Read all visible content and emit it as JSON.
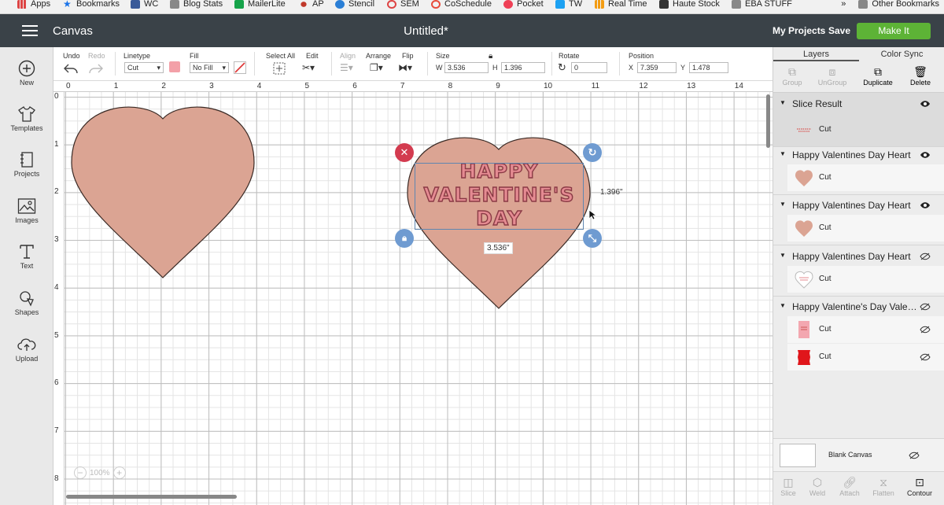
{
  "bookmarks": {
    "items": [
      {
        "label": "Apps",
        "color": "#d44"
      },
      {
        "label": "Bookmarks",
        "color": "#1a73e8"
      },
      {
        "label": "WC",
        "color": "#3a5a99"
      },
      {
        "label": "Blog Stats",
        "color": "#888"
      },
      {
        "label": "MailerLite",
        "color": "#16a34a"
      },
      {
        "label": "AP",
        "color": "#c0392b"
      },
      {
        "label": "Stencil",
        "color": "#2b7fd6"
      },
      {
        "label": "SEM",
        "color": "#d44"
      },
      {
        "label": "CoSchedule",
        "color": "#e74c3c"
      },
      {
        "label": "Pocket",
        "color": "#ef4056"
      },
      {
        "label": "TW",
        "color": "#1da1f2"
      },
      {
        "label": "Real Time",
        "color": "#f39c12"
      },
      {
        "label": "Haute Stock",
        "color": "#333"
      },
      {
        "label": "EBA STUFF",
        "color": "#888"
      }
    ],
    "overflow": "»",
    "other": "Other Bookmarks"
  },
  "topbar": {
    "app_title": "Canvas",
    "doc_title": "Untitled*",
    "my_projects": "My Projects",
    "save": "Save",
    "make_it": "Make It",
    "make_color": "#5db336"
  },
  "leftbar": {
    "items": [
      {
        "label": "New",
        "icon": "plus-circle-icon"
      },
      {
        "label": "Templates",
        "icon": "tshirt-icon"
      },
      {
        "label": "Projects",
        "icon": "projects-icon"
      },
      {
        "label": "Images",
        "icon": "image-icon"
      },
      {
        "label": "Text",
        "icon": "text-icon"
      },
      {
        "label": "Shapes",
        "icon": "shapes-icon"
      },
      {
        "label": "Upload",
        "icon": "upload-icon"
      }
    ]
  },
  "toolbar": {
    "undo": "Undo",
    "redo": "Redo",
    "linetype_label": "Linetype",
    "linetype_value": "Cut",
    "fill_label": "Fill",
    "fill_value": "No Fill",
    "fill_color": "#f3a0a8",
    "select_all": "Select All",
    "edit": "Edit",
    "align": "Align",
    "arrange": "Arrange",
    "flip": "Flip",
    "size_label": "Size",
    "w_label": "W",
    "w_value": "3.536",
    "h_label": "H",
    "h_value": "1.396",
    "rotate_label": "Rotate",
    "rotate_value": "0",
    "position_label": "Position",
    "x_label": "X",
    "x_value": "7.359",
    "y_label": "Y",
    "y_value": "1.478"
  },
  "canvas": {
    "ruler_top": [
      "0",
      "1",
      "2",
      "3",
      "4",
      "5",
      "6",
      "7",
      "8",
      "9",
      "10",
      "11",
      "12",
      "13",
      "14"
    ],
    "ruler_left": [
      "0",
      "1",
      "2",
      "3",
      "4",
      "5",
      "6",
      "7",
      "8"
    ],
    "heart_color": "#dba493",
    "text_lines": [
      "HAPPY",
      "VALENTINE'S",
      "DAY"
    ],
    "height_label": "1.396\"",
    "width_label": "3.536\"",
    "zoom": "100%"
  },
  "rpanel": {
    "tabs": [
      "Layers",
      "Color Sync"
    ],
    "actions": {
      "group": "Group",
      "ungroup": "UnGroup",
      "duplicate": "Duplicate",
      "delete": "Delete"
    },
    "layers": [
      {
        "name": "Slice Result",
        "row": "Cut"
      },
      {
        "name": "Happy Valentines Day Heart",
        "row": "Cut"
      },
      {
        "name": "Happy Valentines Day Heart",
        "row": "Cut"
      },
      {
        "name": "Happy Valentines Day Heart",
        "row": "Cut"
      },
      {
        "name": "Happy Valentine's Day Valentine's Day",
        "rows": [
          "Cut",
          "Cut"
        ]
      }
    ],
    "blank_canvas": "Blank Canvas",
    "bottom": {
      "slice": "Slice",
      "weld": "Weld",
      "attach": "Attach",
      "flatten": "Flatten",
      "contour": "Contour"
    }
  }
}
